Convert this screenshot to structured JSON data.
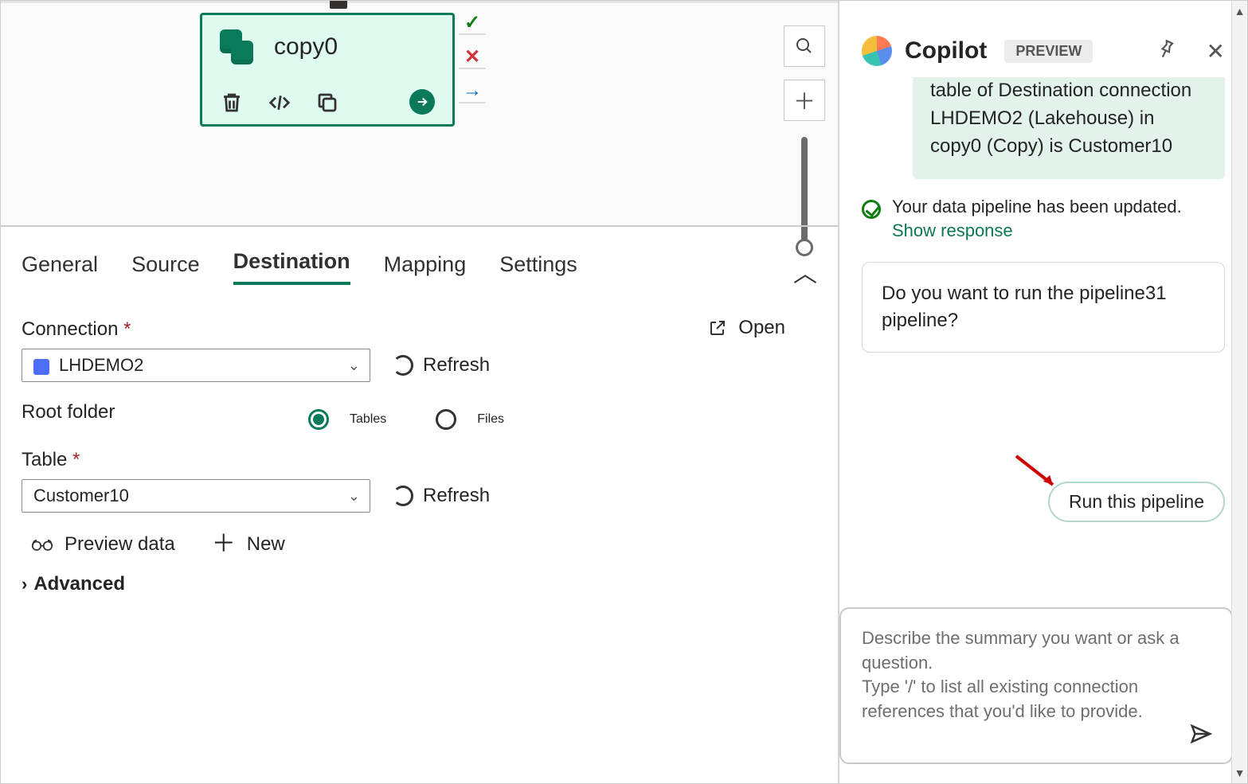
{
  "canvas": {
    "activity_name": "copy0",
    "status_icons": {
      "success": "check",
      "fail": "cross",
      "skip": "arrow"
    }
  },
  "tabs": {
    "items": [
      "General",
      "Source",
      "Destination",
      "Mapping",
      "Settings"
    ],
    "active_index": 2
  },
  "destination": {
    "connection_label": "Connection",
    "connection_value": "LHDEMO2",
    "open_label": "Open",
    "refresh_label": "Refresh",
    "root_folder_label": "Root folder",
    "root_folder_options": {
      "tables": "Tables",
      "files": "Files"
    },
    "root_folder_selected": "tables",
    "table_label": "Table",
    "table_value": "Customer10",
    "preview_label": "Preview data",
    "new_label": "New",
    "advanced_label": "Advanced"
  },
  "copilot": {
    "title": "Copilot",
    "badge": "PREVIEW",
    "green_message": "table of Destination connection LHDEMO2 (Lakehouse) in copy0 (Copy) is Customer10",
    "status_text": "Your data pipeline has been updated.",
    "show_response": "Show response",
    "question_card": "Do you want to run the pipeline31 pipeline?",
    "run_button": "Run this pipeline",
    "input_placeholder": "Describe the summary you want or ask a question.\nType '/' to list all existing connection references that you'd like to provide."
  }
}
